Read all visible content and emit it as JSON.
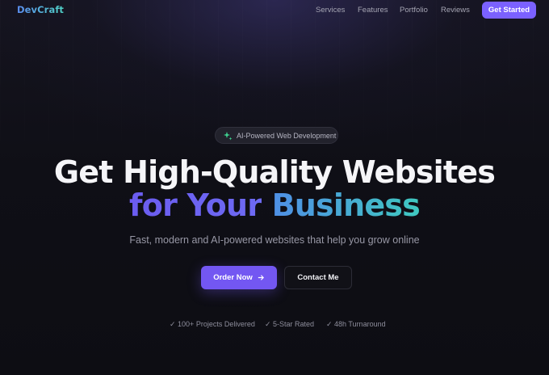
{
  "brand": {
    "logo_text": "DevCraft"
  },
  "nav": {
    "links": [
      "Services",
      "Features",
      "Portfolio",
      "Reviews"
    ],
    "cta_label": "Get Started"
  },
  "hero": {
    "badge": {
      "icon": "sparkle-icon",
      "label": "AI-Powered Web Development"
    },
    "headline_line1": "Get High-Quality Websites",
    "headline_line2_part1": "for Your",
    "headline_line2_part2": "Business",
    "subtitle": "Fast, modern and AI-powered websites that help you grow online",
    "primary_button": "Order Now",
    "secondary_button": "Contact Me",
    "features": [
      "✓ 100+ Projects Delivered",
      "✓ 5-Star Rated",
      "✓ 48h Turnaround"
    ]
  },
  "colors": {
    "background": "#0e0e14",
    "accent_purple": "#7357f2",
    "gradient_blue": "#4f8fe6",
    "gradient_teal": "#3fc8c0",
    "badge_icon_green": "#3ecf8e"
  }
}
